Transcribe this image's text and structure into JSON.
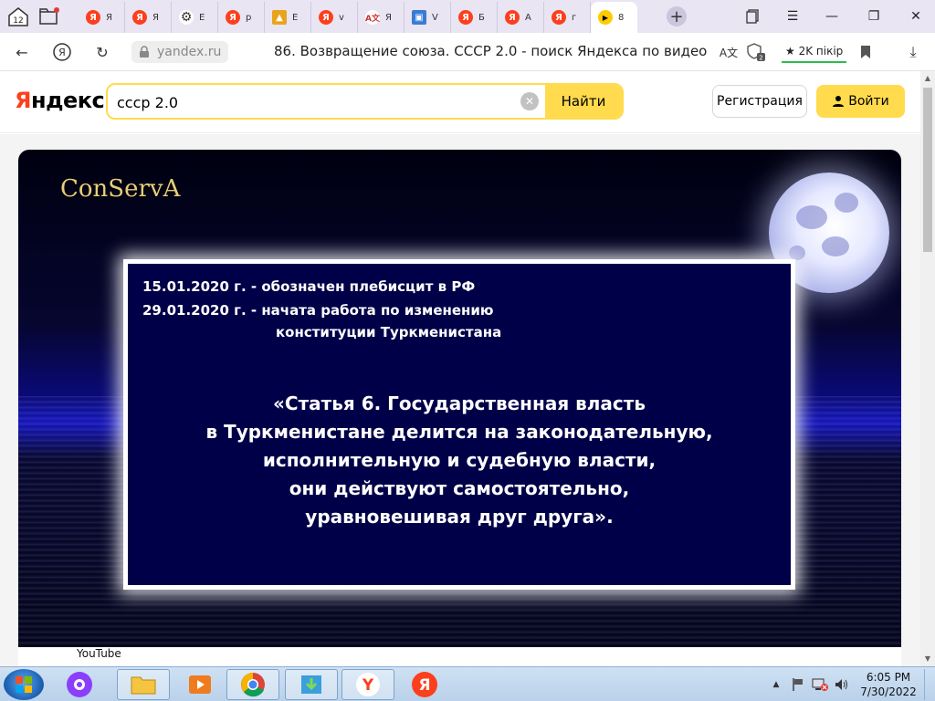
{
  "tabbar": {
    "tab_count": "12",
    "tabs": [
      {
        "label": "Я",
        "favicon": "yandex-icon",
        "color": "#fc3f1d"
      },
      {
        "label": "Я",
        "favicon": "yandex-icon",
        "color": "#fc3f1d"
      },
      {
        "label": "E",
        "favicon": "gear-icon",
        "color": "#444444"
      },
      {
        "label": "р",
        "favicon": "yandex-icon",
        "color": "#fc3f1d"
      },
      {
        "label": "E",
        "favicon": "image-icon",
        "color": "#e8a41c"
      },
      {
        "label": "v",
        "favicon": "yandex-icon",
        "color": "#fc3f1d"
      },
      {
        "label": "Я",
        "favicon": "translate-icon",
        "color": "#d33"
      },
      {
        "label": "V",
        "favicon": "computer-icon",
        "color": "#3a7bd5"
      },
      {
        "label": "Б",
        "favicon": "yandex-icon",
        "color": "#fc3f1d"
      },
      {
        "label": "А",
        "favicon": "yandex-icon",
        "color": "#fc3f1d"
      },
      {
        "label": "г",
        "favicon": "yandex-icon",
        "color": "#fc3f1d"
      },
      {
        "label": "8",
        "favicon": "video-play-icon",
        "color": "#ffcc00"
      }
    ]
  },
  "addressbar": {
    "host": "yandex.ru",
    "title": "86. Возвращение союза. СССР 2.0 - поиск Яндекса по видео",
    "tabs_badge": "2",
    "review_label": "★ 2K пікір"
  },
  "header": {
    "logo": "Яндекс",
    "search_value": "ссср 2.0",
    "find_label": "Найти",
    "register_label": "Регистрация",
    "login_label": "Войти"
  },
  "video": {
    "channel_logo": "ConServA",
    "line1": "15.01.2020 г. - обозначен плебисцит в РФ",
    "line2": "29.01.2020 г. - начата работа по изменению",
    "line3": "конституции Туркменистана",
    "quote": [
      "«Статья 6. Государственная власть",
      "в Туркменистане делится на законодательную,",
      "исполнительную и судебную власти,",
      "они действуют самостоятельно,",
      "уравновешивая друг друга»."
    ],
    "source_label": "YouTube"
  },
  "taskbar": {
    "time": "6:05 PM",
    "date": "7/30/2022"
  },
  "colors": {
    "accent_yellow": "#ffdb4d",
    "yandex_red": "#fc3f1d",
    "panel_navy": "#000048"
  }
}
